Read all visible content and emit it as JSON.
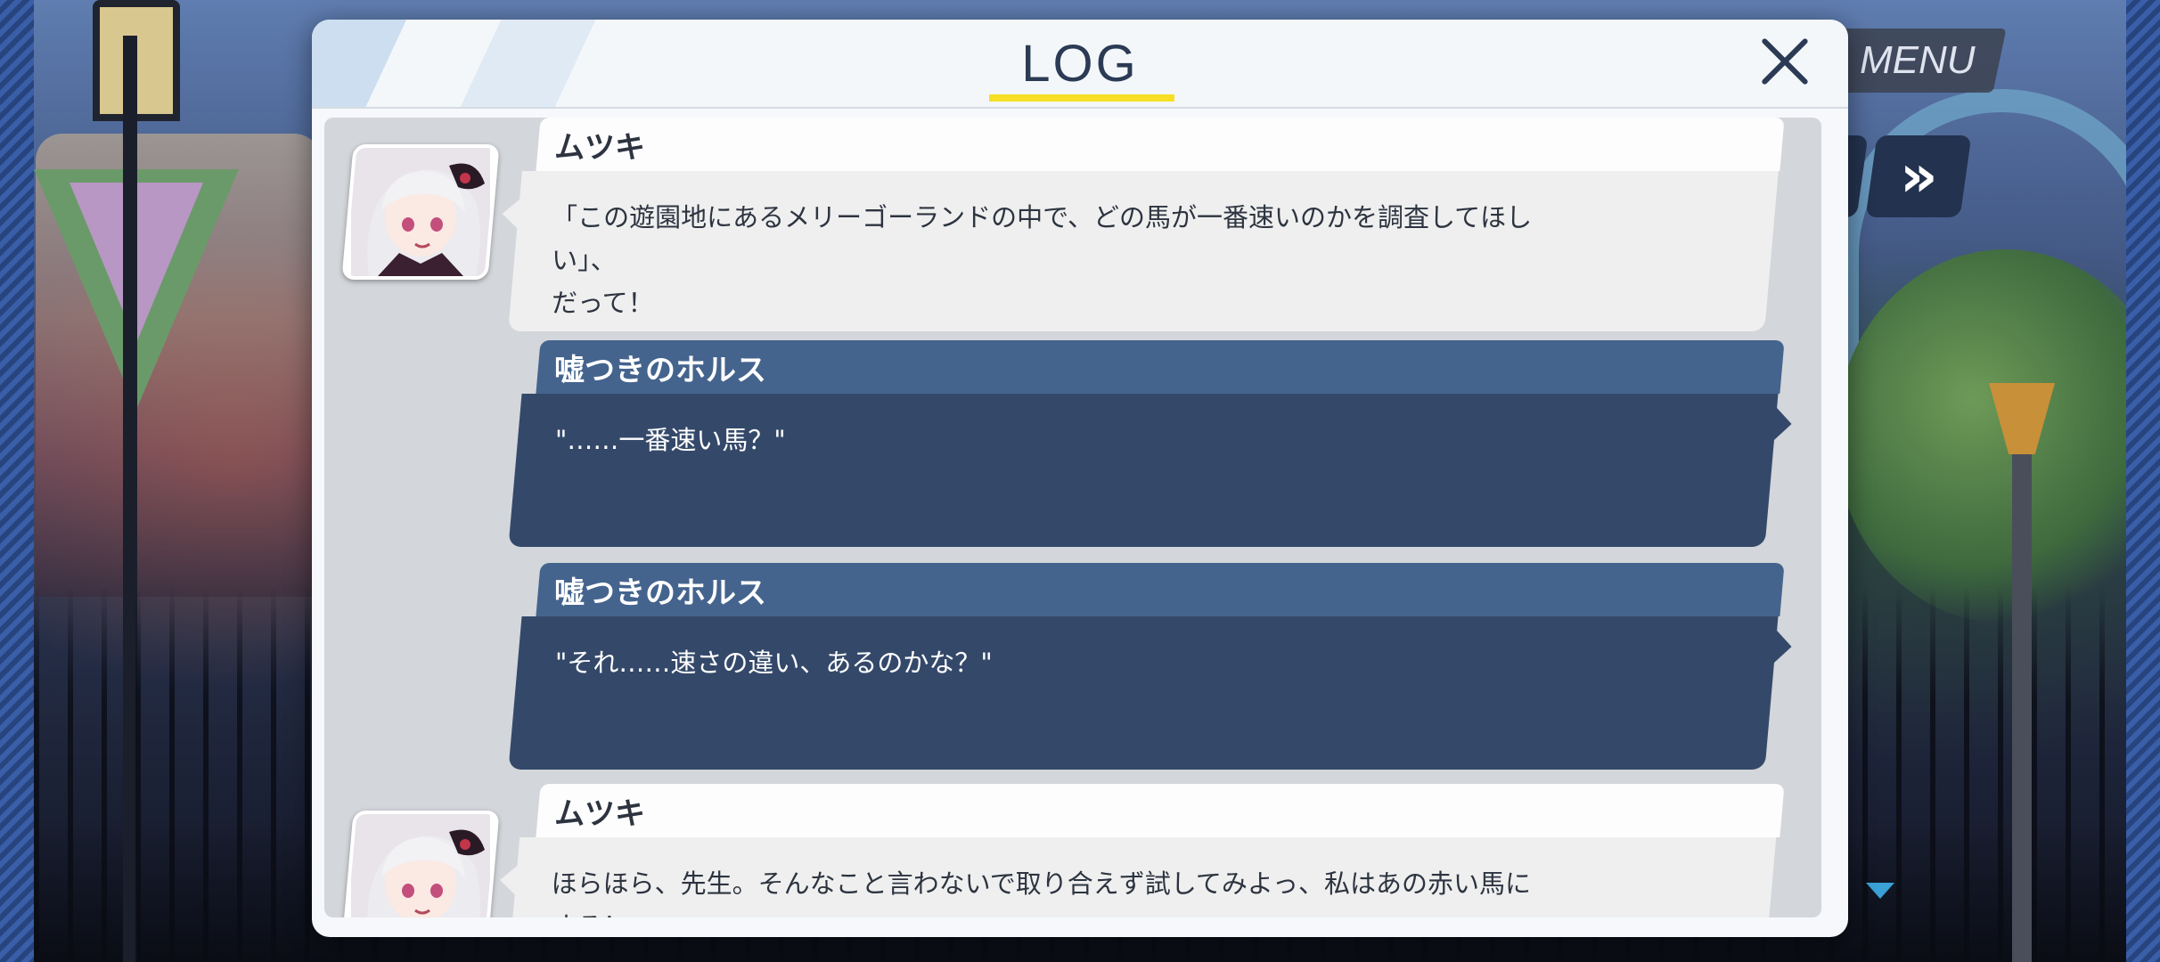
{
  "hud": {
    "menu_label": "MENU",
    "fast_forward_label": "»"
  },
  "log": {
    "title": "LOG",
    "entries": [
      {
        "speaker": "ムツキ",
        "text": "「この遊園地にあるメリーゴーランドの中で、どの馬が一番速いのかを調査してほしい」、\nだって！",
        "type": "npc",
        "has_avatar": true
      },
      {
        "speaker": "嘘つきのホルス",
        "text": "\"……一番速い馬？\"",
        "type": "self",
        "has_avatar": false
      },
      {
        "speaker": "嘘つきのホルス",
        "text": "\"それ……速さの違い、あるのかな？\"",
        "type": "self",
        "has_avatar": false
      },
      {
        "speaker": "ムツキ",
        "text": "ほらほら、先生。そんなこと言わないで取り合えず試してみよっ、私はあの赤い馬にする！",
        "type": "npc",
        "has_avatar": true
      }
    ]
  },
  "colors": {
    "accent_underline": "#f7df26",
    "npc_bubble": "#efefef",
    "self_bubble": "#34496a",
    "self_name_bar": "#44648e"
  },
  "icons": {
    "close": "close-icon",
    "scroll_down": "triangle-down-icon",
    "fast_forward": "fast-forward-icon"
  }
}
